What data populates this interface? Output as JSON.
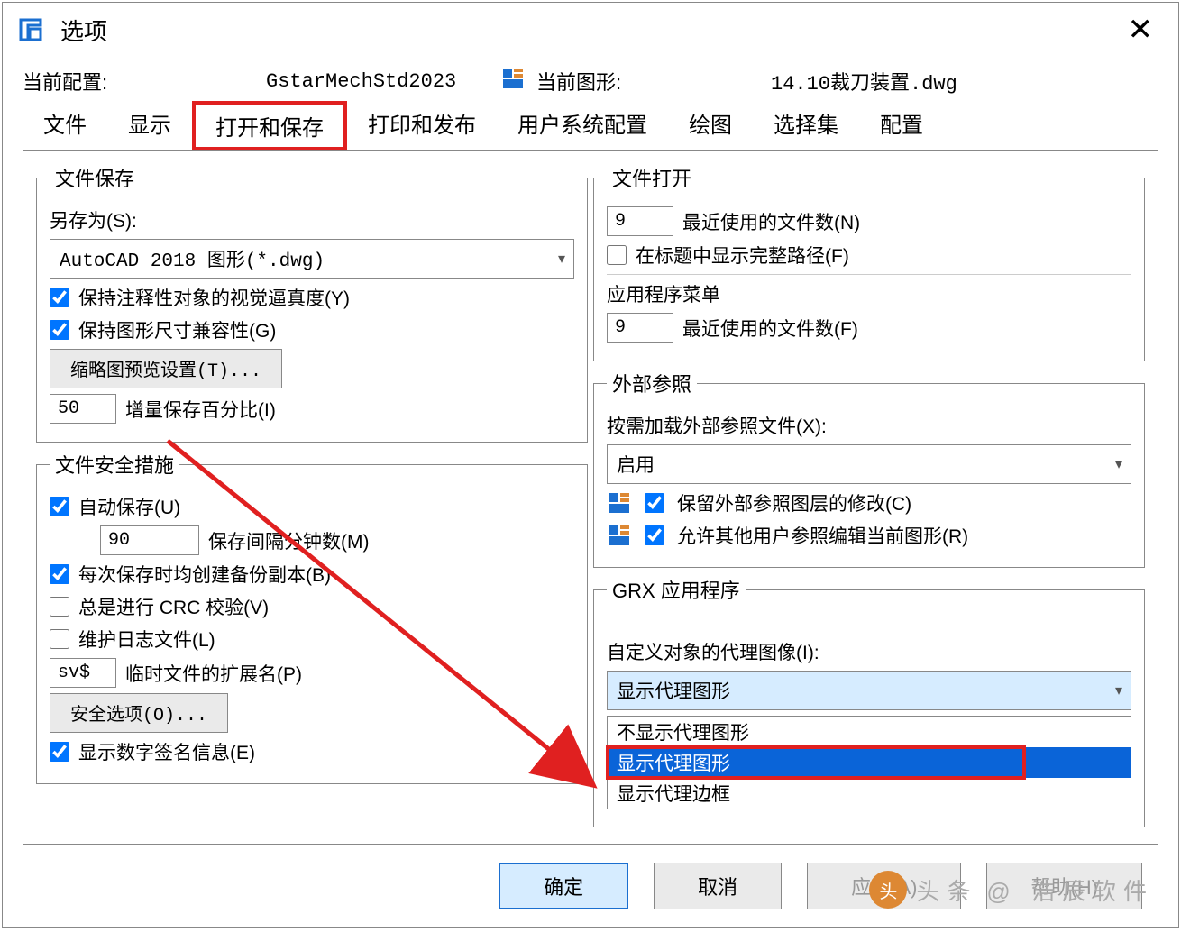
{
  "window": {
    "title": "选项"
  },
  "header": {
    "current_config_label": "当前配置:",
    "current_config_value": "GstarMechStd2023",
    "current_drawing_label": "当前图形:",
    "current_drawing_value": "14.10裁刀装置.dwg"
  },
  "tabs": [
    "文件",
    "显示",
    "打开和保存",
    "打印和发布",
    "用户系统配置",
    "绘图",
    "选择集",
    "配置"
  ],
  "active_tab_index": 2,
  "file_save": {
    "legend": "文件保存",
    "save_as_label": "另存为(S):",
    "save_as_value": "AutoCAD 2018 图形(*.dwg)",
    "chk_visual_fidelity": "保持注释性对象的视觉逼真度(Y)",
    "chk_size_compat": "保持图形尺寸兼容性(G)",
    "btn_thumb": "缩略图预览设置(T)...",
    "incr_value": "50",
    "incr_label": "增量保存百分比(I)"
  },
  "file_safety": {
    "legend": "文件安全措施",
    "chk_autosave": "自动保存(U)",
    "autosave_value": "90",
    "autosave_label": "保存间隔分钟数(M)",
    "chk_backup": "每次保存时均创建备份副本(B)",
    "chk_crc": "总是进行 CRC 校验(V)",
    "chk_log": "维护日志文件(L)",
    "temp_ext_value": "sv$",
    "temp_ext_label": "临时文件的扩展名(P)",
    "btn_security": "安全选项(O)...",
    "chk_digsig": "显示数字签名信息(E)"
  },
  "file_open": {
    "legend": "文件打开",
    "recent_value": "9",
    "recent_label": "最近使用的文件数(N)",
    "chk_fullpath": "在标题中显示完整路径(F)"
  },
  "app_menu": {
    "legend": "应用程序菜单",
    "recent_value": "9",
    "recent_label": "最近使用的文件数(F)"
  },
  "xref": {
    "legend": "外部参照",
    "load_label": "按需加载外部参照文件(X):",
    "load_value": "启用",
    "chk_retain": "保留外部参照图层的修改(C)",
    "chk_allow": "允许其他用户参照编辑当前图形(R)"
  },
  "grx": {
    "legend": "GRX 应用程序",
    "proxy_label": "自定义对象的代理图像(I):",
    "proxy_selected": "显示代理图形",
    "options": [
      "不显示代理图形",
      "显示代理图形",
      "显示代理边框"
    ]
  },
  "footer": {
    "ok": "确定",
    "cancel": "取消",
    "apply": "应用(A)",
    "help": "帮助(H)"
  },
  "watermark": {
    "prefix": "头条",
    "brand": "@ 浩辰软件"
  }
}
